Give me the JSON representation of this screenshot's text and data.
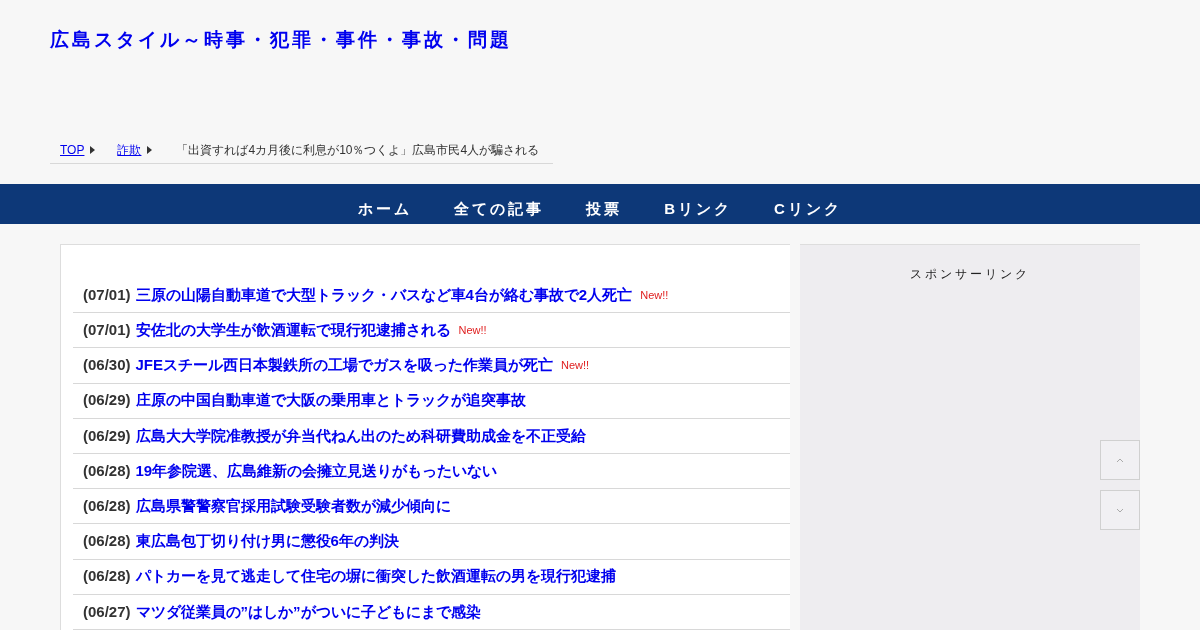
{
  "site_title": "広島スタイル～時事・犯罪・事件・事故・問題",
  "breadcrumb": [
    {
      "label": "TOP",
      "kind": "link"
    },
    {
      "label": "詐欺",
      "kind": "link"
    },
    {
      "label": "「出資すれば4カ月後に利息が10％つくよ」広島市民4人が騙される",
      "kind": "current"
    }
  ],
  "nav": [
    "ホーム",
    "全ての記事",
    "投票",
    "Bリンク",
    "Cリンク"
  ],
  "articles": [
    {
      "date": "(07/01)",
      "title": "三原の山陽自動車道で大型トラック・バスなど車4台が絡む事故で2人死亡",
      "badge": "New!!"
    },
    {
      "date": "(07/01)",
      "title": "安佐北の大学生が飲酒運転で現行犯逮捕される",
      "badge": "New!!"
    },
    {
      "date": "(06/30)",
      "title": "JFEスチール西日本製鉄所の工場でガスを吸った作業員が死亡",
      "badge": "New!!"
    },
    {
      "date": "(06/29)",
      "title": "庄原の中国自動車道で大阪の乗用車とトラックが追突事故"
    },
    {
      "date": "(06/29)",
      "title": "広島大大学院准教授が弁当代ねん出のため科研費助成金を不正受給"
    },
    {
      "date": "(06/28)",
      "title": "19年参院選、広島維新の会擁立見送りがもったいない"
    },
    {
      "date": "(06/28)",
      "title": "広島県警警察官採用試験受験者数が減少傾向に"
    },
    {
      "date": "(06/28)",
      "title": "東広島包丁切り付け男に懲役6年の判決"
    },
    {
      "date": "(06/28)",
      "title": "パトカーを見て逃走して住宅の塀に衝突した飲酒運転の男を現行犯逮捕"
    },
    {
      "date": "(06/27)",
      "title": "マツダ従業員の”はしか”がついに子どもにまで感染"
    }
  ],
  "sidebar": {
    "heading": "スポンサーリンク"
  }
}
